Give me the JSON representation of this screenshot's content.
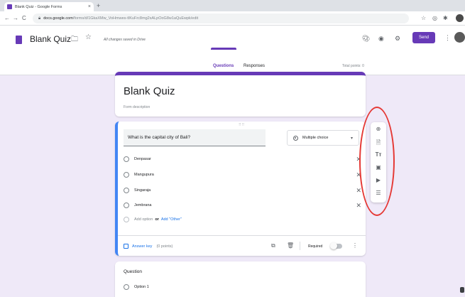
{
  "browser": {
    "tab_title": "Blank Quiz - Google Forms",
    "tab_close": "×",
    "new_tab": "+",
    "url_host": "docs.google.com",
    "url_path": "/forms/d/1GkaXMw_VoHmwes-tIKuFrc8mg2sALpOoG8w1aQuEwpk/edit",
    "back": "←",
    "forward": "→",
    "reload": "C"
  },
  "header": {
    "form_name": "Blank Quiz",
    "saved_status": "All changes saved in Drive",
    "send_label": "Send",
    "tabs": [
      {
        "label": "Questions",
        "active": true
      },
      {
        "label": "Responses",
        "active": false
      }
    ],
    "total_points": "Total points: 0"
  },
  "title_card": {
    "title": "Blank Quiz",
    "description": "Form description"
  },
  "question_card": {
    "question": "What is the capital city of Bali?",
    "type": "Multiple choice",
    "options": [
      {
        "label": "Denpasar"
      },
      {
        "label": "Mangupura"
      },
      {
        "label": "Singaraja"
      },
      {
        "label": "Jembrana"
      }
    ],
    "add_option": "Add option",
    "or": "or",
    "add_other": "Add \"Other\"",
    "answer_key": "Answer key",
    "points": "(0 points)",
    "required": "Required"
  },
  "second_card": {
    "title": "Question",
    "option": "Option 1"
  },
  "colors": {
    "accent": "#673ab7",
    "active_border": "#4285f4",
    "link": "#1a73e8",
    "annotation_ring": "#e53935",
    "page_bg": "#efe9f8"
  },
  "toolbar": {
    "items": [
      "add-question-icon",
      "import-questions-icon",
      "add-title-icon",
      "add-image-icon",
      "add-video-icon",
      "add-section-icon"
    ],
    "title_glyph": "Tт"
  }
}
